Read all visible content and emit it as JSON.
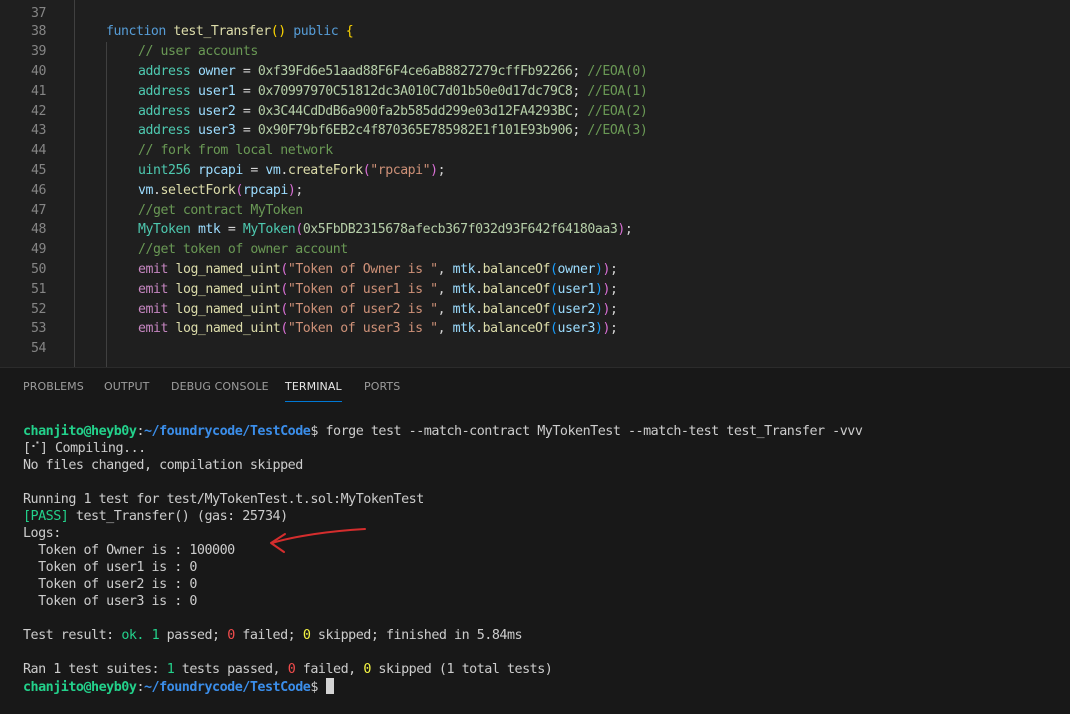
{
  "editor": {
    "lines": [
      {
        "n": "37",
        "tokens": []
      },
      {
        "n": "38",
        "tokens": [
          [
            "k",
            "function "
          ],
          [
            "f",
            "test_Transfer"
          ],
          [
            "b1",
            "()"
          ],
          [
            "p",
            " "
          ],
          [
            "k",
            "public"
          ],
          [
            "p",
            " "
          ],
          [
            "b1",
            "{"
          ]
        ]
      },
      {
        "n": "39",
        "tokens": [
          [
            "c",
            "// user accounts"
          ]
        ]
      },
      {
        "n": "40",
        "tokens": [
          [
            "t",
            "address"
          ],
          [
            "p",
            " "
          ],
          [
            "v",
            "owner"
          ],
          [
            "p",
            " = "
          ],
          [
            "n",
            "0xf39Fd6e51aad88F6F4ce6aB8827279cffFb92266"
          ],
          [
            "p",
            "; "
          ],
          [
            "c",
            "//EOA(0)"
          ]
        ]
      },
      {
        "n": "41",
        "tokens": [
          [
            "t",
            "address"
          ],
          [
            "p",
            " "
          ],
          [
            "v",
            "user1"
          ],
          [
            "p",
            " = "
          ],
          [
            "n",
            "0x70997970C51812dc3A010C7d01b50e0d17dc79C8"
          ],
          [
            "p",
            "; "
          ],
          [
            "c",
            "//EOA(1)"
          ]
        ]
      },
      {
        "n": "42",
        "tokens": [
          [
            "t",
            "address"
          ],
          [
            "p",
            " "
          ],
          [
            "v",
            "user2"
          ],
          [
            "p",
            " = "
          ],
          [
            "n",
            "0x3C44CdDdB6a900fa2b585dd299e03d12FA4293BC"
          ],
          [
            "p",
            "; "
          ],
          [
            "c",
            "//EOA(2)"
          ]
        ]
      },
      {
        "n": "43",
        "tokens": [
          [
            "t",
            "address"
          ],
          [
            "p",
            " "
          ],
          [
            "v",
            "user3"
          ],
          [
            "p",
            " = "
          ],
          [
            "n",
            "0x90F79bf6EB2c4f870365E785982E1f101E93b906"
          ],
          [
            "p",
            "; "
          ],
          [
            "c",
            "//EOA(3)"
          ]
        ]
      },
      {
        "n": "44",
        "tokens": [
          [
            "c",
            "// fork from local network"
          ]
        ]
      },
      {
        "n": "45",
        "tokens": [
          [
            "t",
            "uint256"
          ],
          [
            "p",
            " "
          ],
          [
            "v",
            "rpcapi"
          ],
          [
            "p",
            " = "
          ],
          [
            "v",
            "vm"
          ],
          [
            "p",
            "."
          ],
          [
            "f",
            "createFork"
          ],
          [
            "b2",
            "("
          ],
          [
            "s",
            "\"rpcapi\""
          ],
          [
            "b2",
            ")"
          ],
          [
            "p",
            ";"
          ]
        ]
      },
      {
        "n": "46",
        "tokens": [
          [
            "v",
            "vm"
          ],
          [
            "p",
            "."
          ],
          [
            "f",
            "selectFork"
          ],
          [
            "b2",
            "("
          ],
          [
            "v",
            "rpcapi"
          ],
          [
            "b2",
            ")"
          ],
          [
            "p",
            ";"
          ]
        ]
      },
      {
        "n": "47",
        "tokens": [
          [
            "c",
            "//get contract MyToken"
          ]
        ]
      },
      {
        "n": "48",
        "tokens": [
          [
            "t",
            "MyToken"
          ],
          [
            "p",
            " "
          ],
          [
            "v",
            "mtk"
          ],
          [
            "p",
            " = "
          ],
          [
            "t",
            "MyToken"
          ],
          [
            "b2",
            "("
          ],
          [
            "n",
            "0x5FbDB2315678afecb367f032d93F642f64180aa3"
          ],
          [
            "b2",
            ")"
          ],
          [
            "p",
            ";"
          ]
        ]
      },
      {
        "n": "49",
        "tokens": [
          [
            "c",
            "//get token of owner account"
          ]
        ]
      },
      {
        "n": "50",
        "tokens": [
          [
            "e",
            "emit"
          ],
          [
            "p",
            " "
          ],
          [
            "f",
            "log_named_uint"
          ],
          [
            "b2",
            "("
          ],
          [
            "s",
            "\"Token of Owner is \""
          ],
          [
            "p",
            ", "
          ],
          [
            "v",
            "mtk"
          ],
          [
            "p",
            "."
          ],
          [
            "f",
            "balanceOf"
          ],
          [
            "b3",
            "("
          ],
          [
            "v",
            "owner"
          ],
          [
            "b3",
            ")"
          ],
          [
            "b2",
            ")"
          ],
          [
            "p",
            ";"
          ]
        ]
      },
      {
        "n": "51",
        "tokens": [
          [
            "e",
            "emit"
          ],
          [
            "p",
            " "
          ],
          [
            "f",
            "log_named_uint"
          ],
          [
            "b2",
            "("
          ],
          [
            "s",
            "\"Token of user1 is \""
          ],
          [
            "p",
            ", "
          ],
          [
            "v",
            "mtk"
          ],
          [
            "p",
            "."
          ],
          [
            "f",
            "balanceOf"
          ],
          [
            "b3",
            "("
          ],
          [
            "v",
            "user1"
          ],
          [
            "b3",
            ")"
          ],
          [
            "b2",
            ")"
          ],
          [
            "p",
            ";"
          ]
        ]
      },
      {
        "n": "52",
        "tokens": [
          [
            "e",
            "emit"
          ],
          [
            "p",
            " "
          ],
          [
            "f",
            "log_named_uint"
          ],
          [
            "b2",
            "("
          ],
          [
            "s",
            "\"Token of user2 is \""
          ],
          [
            "p",
            ", "
          ],
          [
            "v",
            "mtk"
          ],
          [
            "p",
            "."
          ],
          [
            "f",
            "balanceOf"
          ],
          [
            "b3",
            "("
          ],
          [
            "v",
            "user2"
          ],
          [
            "b3",
            ")"
          ],
          [
            "b2",
            ")"
          ],
          [
            "p",
            ";"
          ]
        ]
      },
      {
        "n": "53",
        "tokens": [
          [
            "e",
            "emit"
          ],
          [
            "p",
            " "
          ],
          [
            "f",
            "log_named_uint"
          ],
          [
            "b2",
            "("
          ],
          [
            "s",
            "\"Token of user3 is \""
          ],
          [
            "p",
            ", "
          ],
          [
            "v",
            "mtk"
          ],
          [
            "p",
            "."
          ],
          [
            "f",
            "balanceOf"
          ],
          [
            "b3",
            "("
          ],
          [
            "v",
            "user3"
          ],
          [
            "b3",
            ")"
          ],
          [
            "b2",
            ")"
          ],
          [
            "p",
            ";"
          ]
        ]
      },
      {
        "n": "54",
        "tokens": []
      }
    ]
  },
  "panel": {
    "tabs": [
      {
        "label": "PROBLEMS",
        "active": false
      },
      {
        "label": "OUTPUT",
        "active": false
      },
      {
        "label": "DEBUG CONSOLE",
        "active": false
      },
      {
        "label": "TERMINAL",
        "active": true
      },
      {
        "label": "PORTS",
        "active": false
      }
    ]
  },
  "terminal": {
    "prompt_user": "chanjito@heyb0y",
    "prompt_sep": ":",
    "prompt_path": "~/foundrycode/TestCode",
    "prompt_dollar": "$",
    "command": " forge test --match-contract MyTokenTest --match-test test_Transfer -vvv",
    "compiling": "[⠊] Compiling...",
    "no_changes": "No files changed, compilation skipped",
    "running": "Running 1 test for test/MyTokenTest.t.sol:MyTokenTest",
    "pass_tag": "[PASS]",
    "pass_rest": " test_Transfer() (gas: 25734)",
    "logs_header": "Logs:",
    "logs": [
      "  Token of Owner is : 100000",
      "  Token of user1 is : 0",
      "  Token of user2 is : 0",
      "  Token of user3 is : 0"
    ],
    "result_prefix": "Test result: ",
    "result_ok": "ok.",
    "result_passed_n": "1",
    "result_passed_label": " passed; ",
    "result_failed_n": "0",
    "result_failed_label": " failed; ",
    "result_skipped_n": "0",
    "result_skipped_label": " skipped; finished in 5.84ms",
    "summary_prefix": "Ran 1 test suites: ",
    "summary_passed_n": "1",
    "summary_passed_label": " tests passed, ",
    "summary_failed_n": "0",
    "summary_failed_label": " failed, ",
    "summary_skipped_n": "0",
    "summary_skipped_label": " skipped (1 total tests)"
  },
  "annotation": {
    "color": "#d42d2d",
    "icon": "red-arrow-icon"
  }
}
